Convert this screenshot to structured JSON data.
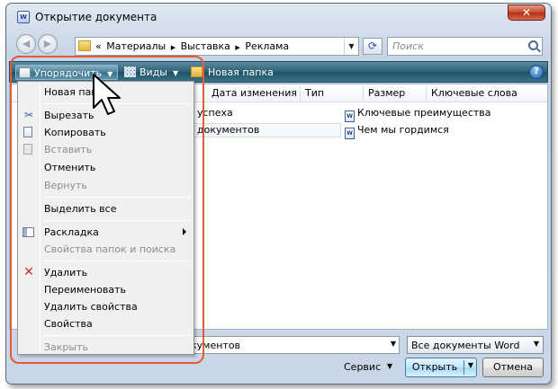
{
  "window": {
    "title": "Открытие документа",
    "close_label": "✕"
  },
  "navigation": {
    "back_label": "◀",
    "forward_label": "▶",
    "breadcrumb": [
      "«",
      "Материалы",
      "▶",
      "Выставка",
      "▶",
      "Реклама"
    ],
    "search_placeholder": "Поиск"
  },
  "toolbar": {
    "organize_label": "Упорядочить",
    "views_label": "Виды",
    "new_folder_label": "Новая папка",
    "help_label": "?"
  },
  "columns": [
    "Дата изменения",
    "Тип",
    "Размер",
    "Ключевые слова"
  ],
  "files": [
    {
      "name": "успеха",
      "icon": "word-document-icon"
    },
    {
      "name": "документов",
      "icon": "word-document-icon"
    },
    {
      "name": "Ключевые преимущества",
      "icon": "word-document-icon"
    },
    {
      "name": "Чем мы гордимся",
      "icon": "word-document-icon"
    }
  ],
  "bottom": {
    "filename_value": "кументов",
    "filetype_value": "Все документы Word",
    "service_label": "Сервис",
    "open_label": "Открыть",
    "cancel_label": "Отмена"
  },
  "organize_menu": {
    "items": [
      {
        "label": "Новая папка",
        "enabled": true
      },
      {
        "label": "Вырезать",
        "enabled": true,
        "icon": "scissors-icon"
      },
      {
        "label": "Копировать",
        "enabled": true,
        "icon": "copy-icon"
      },
      {
        "label": "Вставить",
        "enabled": false,
        "icon": "paste-icon"
      },
      {
        "label": "Отменить",
        "enabled": true
      },
      {
        "label": "Вернуть",
        "enabled": false
      },
      {
        "label": "Выделить все",
        "enabled": true
      },
      {
        "label": "Раскладка",
        "enabled": true,
        "icon": "layout-icon",
        "submenu": true
      },
      {
        "label": "Свойства папок и поиска",
        "enabled": false
      },
      {
        "label": "Удалить",
        "enabled": true,
        "icon": "delete-icon"
      },
      {
        "label": "Переименовать",
        "enabled": true
      },
      {
        "label": "Удалить свойства",
        "enabled": true
      },
      {
        "label": "Свойства",
        "enabled": true
      },
      {
        "label": "Закрыть",
        "enabled": false
      }
    ]
  },
  "colors": {
    "toolbar": "#2f6377",
    "highlight": "#e45b3a",
    "delete_icon": "#d4262a"
  }
}
